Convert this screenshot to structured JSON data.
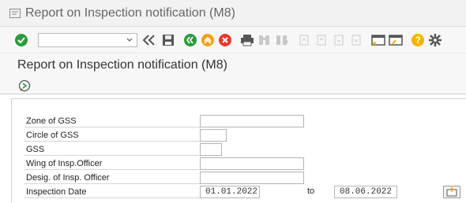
{
  "window": {
    "title": "Report on Inspection notification (M8)"
  },
  "toolbar": {
    "command_field_value": "",
    "icons": [
      "enter-icon",
      "back-icon",
      "save-icon",
      "green-back-icon",
      "exit-icon",
      "cancel-icon",
      "print-icon",
      "find-icon",
      "find-next-icon",
      "first-page-icon",
      "prev-page-icon",
      "next-page-icon",
      "last-page-icon",
      "create-session-icon",
      "shortcut-icon",
      "help-icon",
      "settings-icon"
    ]
  },
  "page": {
    "title": "Report on Inspection notification (M8)"
  },
  "colors": {
    "accent_green": "#2b9a3b",
    "accent_orange": "#f0a21a",
    "accent_red": "#e23b30",
    "accent_yellow": "#f3b400"
  },
  "form": {
    "fields": [
      {
        "label": "Zone of GSS",
        "value": ""
      },
      {
        "label": "Circle of GSS",
        "value": ""
      },
      {
        "label": "GSS",
        "value": ""
      },
      {
        "label": "Wing of Insp.Officer",
        "value": ""
      },
      {
        "label": "Desig. of Insp. Officer",
        "value": ""
      }
    ],
    "inspection_date": {
      "label": "Inspection Date",
      "from": "01.01.2022",
      "to_label": "to",
      "to": "08.06.2022"
    }
  }
}
